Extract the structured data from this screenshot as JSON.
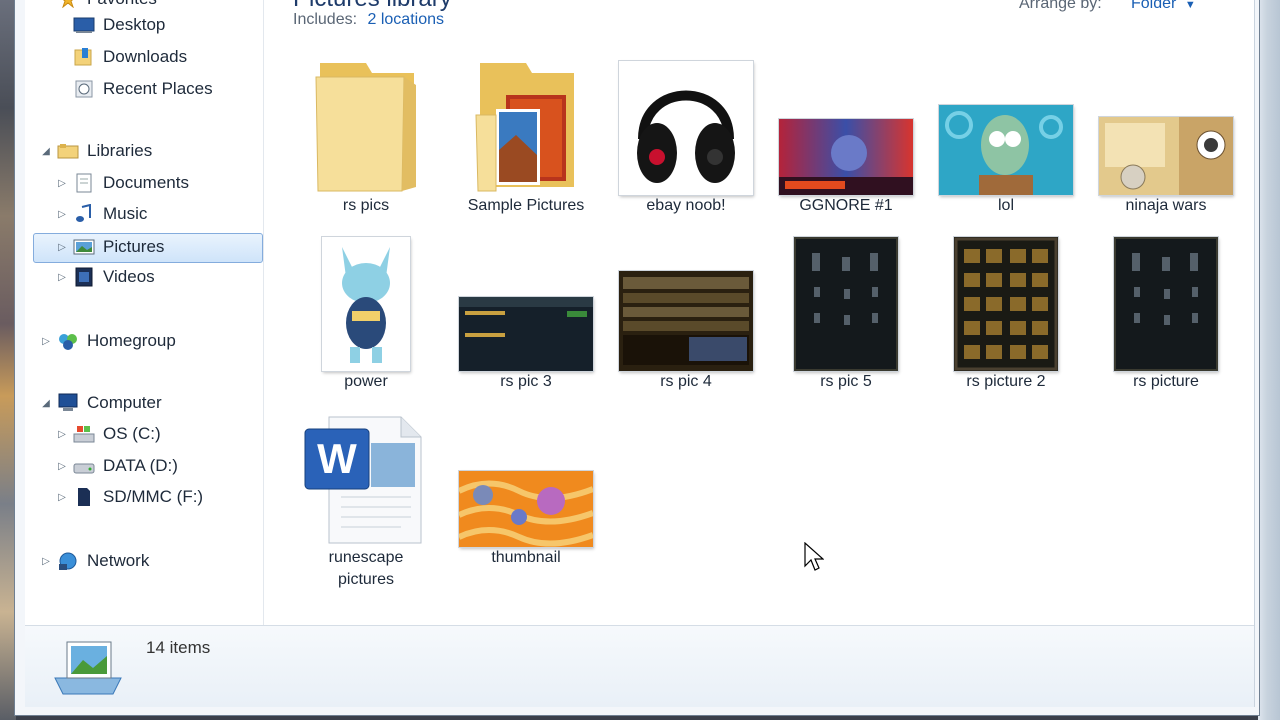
{
  "header": {
    "library_title": "Pictures library",
    "includes_label": "Includes:",
    "includes_link": "2 locations",
    "arrange_label": "Arrange by:",
    "arrange_value": "Folder"
  },
  "nav": {
    "favorites": "Favorites",
    "desktop": "Desktop",
    "downloads": "Downloads",
    "recent": "Recent Places",
    "libraries": "Libraries",
    "documents": "Documents",
    "music": "Music",
    "pictures": "Pictures",
    "videos": "Videos",
    "homegroup": "Homegroup",
    "computer": "Computer",
    "os": "OS (C:)",
    "data": "DATA (D:)",
    "sd": "SD/MMC (F:)",
    "network": "Network"
  },
  "items": [
    {
      "name": "rs pics",
      "kind": "folder"
    },
    {
      "name": "Sample Pictures",
      "kind": "folder-photo"
    },
    {
      "name": "ebay noob!",
      "kind": "image"
    },
    {
      "name": "GGNORE #1",
      "kind": "image"
    },
    {
      "name": "lol",
      "kind": "image"
    },
    {
      "name": "ninaja wars",
      "kind": "image"
    },
    {
      "name": "power",
      "kind": "image"
    },
    {
      "name": "rs pic 3",
      "kind": "image"
    },
    {
      "name": "rs pic 4",
      "kind": "image"
    },
    {
      "name": "rs pic 5",
      "kind": "image"
    },
    {
      "name": "rs picture 2",
      "kind": "image"
    },
    {
      "name": "rs picture",
      "kind": "image"
    },
    {
      "name": "runescape",
      "name2": "pictures",
      "kind": "word-doc"
    },
    {
      "name": "thumbnail",
      "kind": "image"
    }
  ],
  "status": {
    "count": "14 items"
  },
  "colors": {
    "accent": "#1a5fb4",
    "selection": "#cfe4fa",
    "folder": "#f3d27a"
  },
  "icons": {
    "star": "star-icon",
    "desktop": "desktop-icon",
    "downloads": "downloads-icon",
    "recent": "recent-places-icon",
    "library": "library-icon",
    "documents": "documents-icon",
    "music": "music-icon",
    "pictures": "pictures-icon",
    "videos": "videos-icon",
    "homegroup": "homegroup-icon",
    "computer": "computer-icon",
    "drive": "drive-icon",
    "sd": "sd-card-icon",
    "network": "network-icon",
    "cursor": "mouse-cursor-icon"
  }
}
